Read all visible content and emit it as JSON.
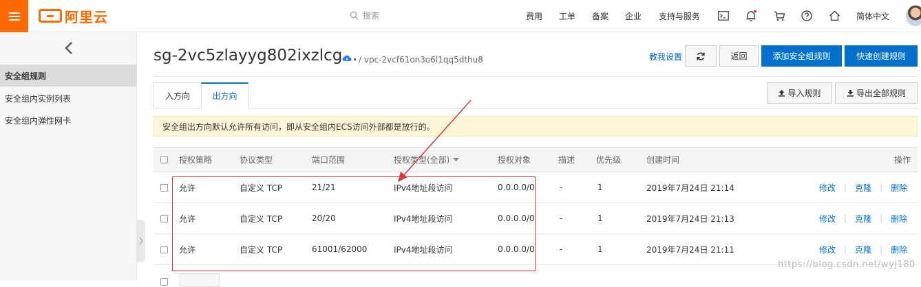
{
  "header": {
    "logo_text": "阿里云",
    "search_placeholder": "搜索",
    "nav": [
      "费用",
      "工单",
      "备案",
      "企业",
      "支持与服务"
    ],
    "language": "简体中文",
    "icons": [
      "terminal-icon",
      "bell-icon",
      "cart-icon",
      "help-icon",
      "home-icon"
    ]
  },
  "sidebar": {
    "items": [
      {
        "label": "安全组规则",
        "active": true
      },
      {
        "label": "安全组内实例列表",
        "active": false
      },
      {
        "label": "安全组内弹性网卡",
        "active": false
      }
    ]
  },
  "page": {
    "title": "sg-2vc5zlayyg802ixzlcg...",
    "vpc": "/ vpc-2vcf61on3o6l1qq5dthu8",
    "teach_link": "教我设置",
    "back_button": "返回",
    "add_rule_button": "添加安全组规则",
    "quick_create_button": "快速创建规则",
    "import_button": "导入规则",
    "export_button": "导出全部规则"
  },
  "tabs": [
    {
      "label": "入方向",
      "active": false
    },
    {
      "label": "出方向",
      "active": true
    }
  ],
  "notice": "安全组出方向默认允许所有访问，即从安全组内ECS访问外部都是放行的。",
  "table": {
    "columns": [
      "授权策略",
      "协议类型",
      "端口范围",
      "授权类型(全部)",
      "授权对象",
      "描述",
      "优先级",
      "创建时间",
      "操作"
    ],
    "rows": [
      {
        "policy": "允许",
        "protocol": "自定义 TCP",
        "port": "21/21",
        "auth_type": "IPv4地址段访问",
        "object": "0.0.0.0/0",
        "desc": "-",
        "priority": "1",
        "created": "2019年7月24日 21:14",
        "ops": [
          "修改",
          "克隆",
          "删除"
        ]
      },
      {
        "policy": "允许",
        "protocol": "自定义 TCP",
        "port": "20/20",
        "auth_type": "IPv4地址段访问",
        "object": "0.0.0.0/0",
        "desc": "-",
        "priority": "1",
        "created": "2019年7月24日 21:13",
        "ops": [
          "修改",
          "克隆",
          "删除"
        ]
      },
      {
        "policy": "允许",
        "protocol": "自定义 TCP",
        "port": "61001/62000",
        "auth_type": "IPv4地址段访问",
        "object": "0.0.0.0/0",
        "desc": "-",
        "priority": "1",
        "created": "2019年7月24日 21:11",
        "ops": [
          "修改",
          "克隆",
          "删除"
        ]
      }
    ]
  },
  "watermark": "https://blog.csdn.net/wyj180",
  "colors": {
    "brand": "#ff6a00",
    "primary": "#0070cc",
    "annotation": "#d9393a",
    "notice_bg": "#fff6d9"
  }
}
